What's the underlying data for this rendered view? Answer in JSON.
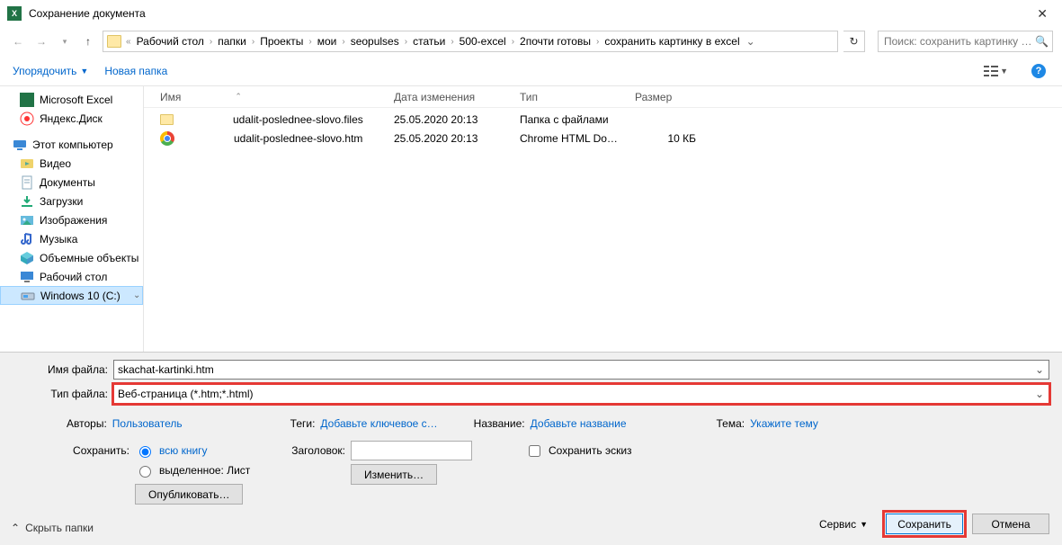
{
  "titlebar": {
    "app": "X",
    "title": "Сохранение документа"
  },
  "nav": {
    "crumbs": [
      "Рабочий стол",
      "папки",
      "Проекты",
      "мои",
      "seopulses",
      "статьи",
      "500-excel",
      "2почти готовы",
      "сохранить картинку в excel"
    ],
    "search_placeholder": "Поиск: сохранить картинку …"
  },
  "toolbar": {
    "organize": "Упорядочить",
    "new_folder": "Новая папка"
  },
  "tree": [
    {
      "name": "Microsoft Excel",
      "ico": "excel"
    },
    {
      "name": "Яндекс.Диск",
      "ico": "yadisk"
    },
    {
      "name": "Этот компьютер",
      "ico": "pc",
      "root": true
    },
    {
      "name": "Видео",
      "ico": "video"
    },
    {
      "name": "Документы",
      "ico": "docs"
    },
    {
      "name": "Загрузки",
      "ico": "down"
    },
    {
      "name": "Изображения",
      "ico": "img"
    },
    {
      "name": "Музыка",
      "ico": "music"
    },
    {
      "name": "Объемные объекты",
      "ico": "3d"
    },
    {
      "name": "Рабочий стол",
      "ico": "desk"
    },
    {
      "name": "Windows 10 (C:)",
      "ico": "drive",
      "selected": true,
      "expand": true
    }
  ],
  "cols": {
    "name": "Имя",
    "date": "Дата изменения",
    "type": "Тип",
    "size": "Размер"
  },
  "files": [
    {
      "name": "udalit-poslednee-slovo.files",
      "date": "25.05.2020 20:13",
      "type": "Папка с файлами",
      "size": "",
      "ico": "folder"
    },
    {
      "name": "udalit-poslednee-slovo.htm",
      "date": "25.05.2020 20:13",
      "type": "Chrome HTML Do…",
      "size": "10 КБ",
      "ico": "chrome"
    }
  ],
  "form": {
    "fname_label": "Имя файла:",
    "fname_value": "skachat-kartinki.htm",
    "ftype_label": "Тип файла:",
    "ftype_value": "Веб-страница (*.htm;*.html)"
  },
  "meta": {
    "authors_l": "Авторы:",
    "authors_v": "Пользователь",
    "tags_l": "Теги:",
    "tags_v": "Добавьте ключевое с…",
    "title_l": "Название:",
    "title_v": "Добавьте название",
    "theme_l": "Тема:",
    "theme_v": "Укажите тему"
  },
  "opts": {
    "save_l": "Сохранить:",
    "r1": "всю книгу",
    "r2": "выделенное: Лист",
    "publish": "Опубликовать…",
    "head_l": "Заголовок:",
    "change": "Изменить…",
    "thumb": "Сохранить эскиз"
  },
  "footer": {
    "service": "Сервис",
    "save": "Сохранить",
    "cancel": "Отмена",
    "hide": "Скрыть папки"
  }
}
